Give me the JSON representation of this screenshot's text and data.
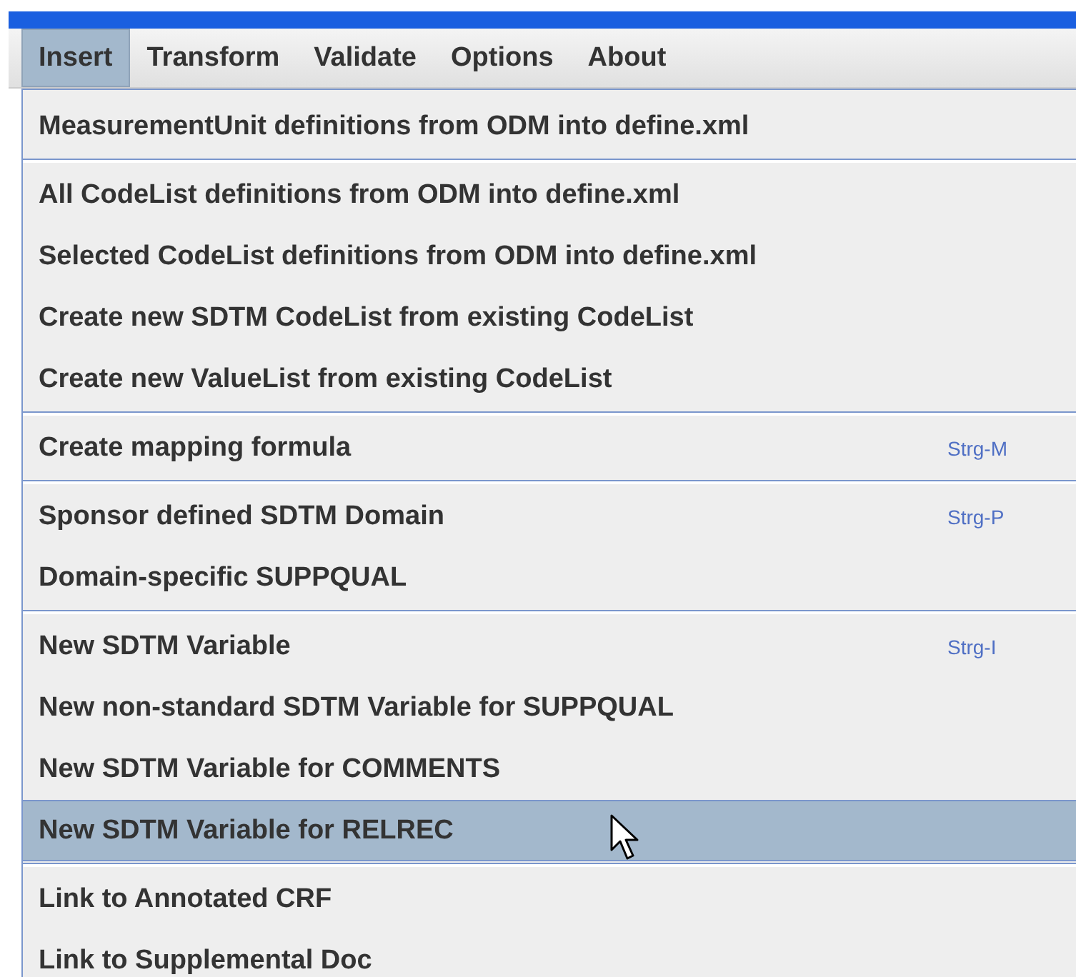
{
  "menu_bar": [
    {
      "label": "Insert",
      "selected": true
    },
    {
      "label": "Transform",
      "selected": false
    },
    {
      "label": "Validate",
      "selected": false
    },
    {
      "label": "Options",
      "selected": false
    },
    {
      "label": "About",
      "selected": false
    }
  ],
  "menu": {
    "groups": [
      {
        "items": [
          {
            "label": "MeasurementUnit definitions from ODM into define.xml",
            "selected": false
          }
        ]
      },
      {
        "items": [
          {
            "label": "All CodeList definitions from ODM into define.xml",
            "selected": false
          },
          {
            "label": "Selected CodeList definitions from ODM into define.xml",
            "selected": false
          },
          {
            "label": "Create new SDTM CodeList from existing CodeList",
            "selected": false
          },
          {
            "label": "Create new ValueList from existing CodeList",
            "selected": false
          }
        ]
      },
      {
        "items": [
          {
            "label": "Create mapping formula",
            "shortcut": "Strg-M",
            "selected": false
          }
        ]
      },
      {
        "items": [
          {
            "label": "Sponsor defined SDTM Domain",
            "shortcut": "Strg-P",
            "selected": false
          },
          {
            "label": "Domain-specific SUPPQUAL",
            "selected": false
          }
        ]
      },
      {
        "items": [
          {
            "label": "New SDTM Variable",
            "shortcut": "Strg-I",
            "selected": false
          },
          {
            "label": "New non-standard SDTM Variable for SUPPQUAL",
            "selected": false
          },
          {
            "label": "New SDTM Variable for COMMENTS",
            "selected": false
          },
          {
            "label": "New SDTM Variable for RELREC",
            "selected": true
          }
        ]
      },
      {
        "items": [
          {
            "label": "Link to Annotated CRF",
            "selected": false
          },
          {
            "label": "Link to Supplemental Doc",
            "selected": false
          }
        ]
      }
    ]
  }
}
